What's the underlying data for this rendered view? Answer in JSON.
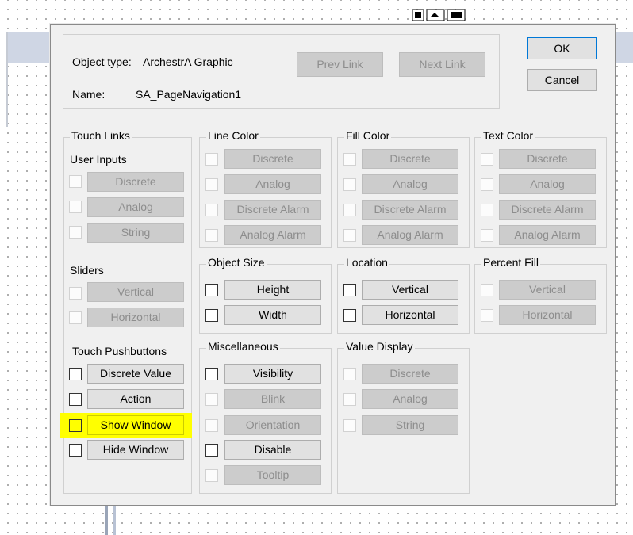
{
  "dialog": {
    "object_type_label": "Object type:",
    "object_type_value": "ArchestrA Graphic",
    "name_label": "Name:",
    "name_value": "SA_PageNavigation1",
    "prev_link": "Prev Link",
    "next_link": "Next Link",
    "ok": "OK",
    "cancel": "Cancel"
  },
  "touch_links": {
    "title": "Touch Links",
    "user_inputs": {
      "title": "User Inputs",
      "discrete": "Discrete",
      "analog": "Analog",
      "string": "String"
    },
    "sliders": {
      "title": "Sliders",
      "vertical": "Vertical",
      "horizontal": "Horizontal"
    },
    "touch_pushbuttons": {
      "title": "Touch Pushbuttons",
      "discrete_value": "Discrete Value",
      "action": "Action",
      "show_window": "Show Window",
      "hide_window": "Hide Window"
    }
  },
  "line_color": {
    "title": "Line Color",
    "discrete": "Discrete",
    "analog": "Analog",
    "discrete_alarm": "Discrete Alarm",
    "analog_alarm": "Analog Alarm"
  },
  "fill_color": {
    "title": "Fill Color",
    "discrete": "Discrete",
    "analog": "Analog",
    "discrete_alarm": "Discrete Alarm",
    "analog_alarm": "Analog Alarm"
  },
  "text_color": {
    "title": "Text Color",
    "discrete": "Discrete",
    "analog": "Analog",
    "discrete_alarm": "Discrete Alarm",
    "analog_alarm": "Analog Alarm"
  },
  "object_size": {
    "title": "Object Size",
    "height": "Height",
    "width": "Width"
  },
  "location": {
    "title": "Location",
    "vertical": "Vertical",
    "horizontal": "Horizontal"
  },
  "percent_fill": {
    "title": "Percent Fill",
    "vertical": "Vertical",
    "horizontal": "Horizontal"
  },
  "miscellaneous": {
    "title": "Miscellaneous",
    "visibility": "Visibility",
    "blink": "Blink",
    "orientation": "Orientation",
    "disable": "Disable",
    "tooltip": "Tooltip"
  },
  "value_display": {
    "title": "Value Display",
    "discrete": "Discrete",
    "analog": "Analog",
    "string": "String"
  },
  "colors": {
    "dialog_bg": "#f0f0f0",
    "highlight": "#ffff00",
    "disabled_button": "#cccccc",
    "default_button_border": "#0078d7"
  }
}
